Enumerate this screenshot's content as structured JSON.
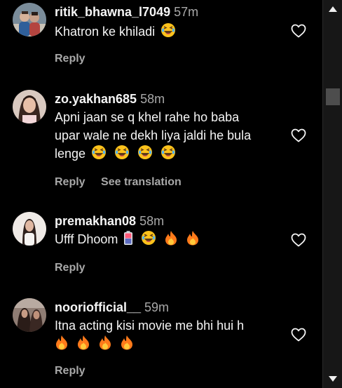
{
  "comments": [
    {
      "username": "ritik_bhawna_l7049",
      "time": "57m",
      "text": "Khatron ke khiladi",
      "emojis": [
        "laughing"
      ],
      "actions": [
        "Reply"
      ]
    },
    {
      "username": "zo.yakhan685",
      "time": "58m",
      "text_lines": [
        "Apni jaan se q khel rahe ho baba",
        "upar wale ne dekh liya jaldi he bula",
        "lenge"
      ],
      "emojis": [
        "laughing",
        "laughing",
        "laughing",
        "laughing"
      ],
      "actions": [
        "Reply",
        "See translation"
      ]
    },
    {
      "username": "premakhan08",
      "time": "58m",
      "text": "Ufff Dhoom",
      "emojis": [
        "battery",
        "laughing",
        "fire",
        "fire"
      ],
      "actions": [
        "Reply"
      ]
    },
    {
      "username": "noorіofficial__",
      "time": "59m",
      "text": "Itna acting kisi movie me bhi hui h",
      "emojis": [
        "fire",
        "fire",
        "fire",
        "fire"
      ],
      "actions": [
        "Reply"
      ]
    }
  ],
  "icons": {
    "like": "heart-outline-icon",
    "scroll_up": "triangle-up-icon",
    "scroll_down": "triangle-down-icon"
  },
  "colors": {
    "background": "#000000",
    "text_primary": "#f5f5f5",
    "text_secondary": "#a8a8a8",
    "scrollbar_track": "#171717",
    "scrollbar_thumb": "#4d4d4d"
  }
}
